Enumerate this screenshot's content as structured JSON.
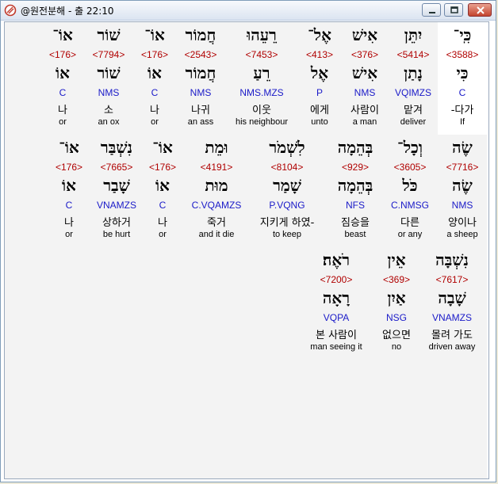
{
  "window": {
    "title": "@원전분해 - 출 22:10",
    "minimize_icon": "minimize-icon",
    "maximize_icon": "maximize-icon",
    "close_icon": "close-icon",
    "app_icon": "app-icon"
  },
  "rows": [
    {
      "words": [
        {
          "hebrew": "כִּֽי־",
          "strong": "<3588>",
          "lemma": "כִּי",
          "parse": "C",
          "korean": "-다가",
          "english": "If",
          "highlighted": true
        },
        {
          "hebrew": "יִתֵּן",
          "strong": "<5414>",
          "lemma": "נָתַן",
          "parse": "VQIMZS",
          "korean": "맡겨",
          "english": "deliver"
        },
        {
          "hebrew": "אִישׁ",
          "strong": "<376>",
          "lemma": "אִישׁ",
          "parse": "NMS",
          "korean": "사람이",
          "english": "a man"
        },
        {
          "hebrew": "אֶל־",
          "strong": "<413>",
          "lemma": "אֶל",
          "parse": "P",
          "korean": "에게",
          "english": "unto"
        },
        {
          "hebrew": "רֵעֵהוּ",
          "strong": "<7453>",
          "lemma": "רֵעַ",
          "parse": "NMS.MZS",
          "korean": "이웃",
          "english": "his neighbour"
        },
        {
          "hebrew": "חֲמוֹר",
          "strong": "<2543>",
          "lemma": "חֲמוֹר",
          "parse": "NMS",
          "korean": "나귀",
          "english": "an ass"
        },
        {
          "hebrew": "אוֹ־",
          "strong": "<176>",
          "lemma": "אוֹ",
          "parse": "C",
          "korean": "나",
          "english": "or"
        },
        {
          "hebrew": "שׁוֹר",
          "strong": "<7794>",
          "lemma": "שׁוֹר",
          "parse": "NMS",
          "korean": "소",
          "english": "an ox"
        },
        {
          "hebrew": "אוֹ־",
          "strong": "<176>",
          "lemma": "אוֹ",
          "parse": "C",
          "korean": "나",
          "english": "or"
        }
      ]
    },
    {
      "words": [
        {
          "hebrew": "שֶׂה",
          "strong": "<7716>",
          "lemma": "שֶׂה",
          "parse": "NMS",
          "korean": "양이나",
          "english": "a sheep"
        },
        {
          "hebrew": "וְכָל־",
          "strong": "<3605>",
          "lemma": "כֹּל",
          "parse": "C.NMSG",
          "korean": "다른",
          "english": "or any"
        },
        {
          "hebrew": "בְּהֵמָה",
          "strong": "<929>",
          "lemma": "בְּהֵמָה",
          "parse": "NFS",
          "korean": "짐승을",
          "english": "beast"
        },
        {
          "hebrew": "לִשְׁמֹר",
          "strong": "<8104>",
          "lemma": "שָׁמַר",
          "parse": "P.VQNG",
          "korean": "지키게 하였-",
          "english": "to keep"
        },
        {
          "hebrew": "וּמֵת",
          "strong": "<4191>",
          "lemma": "מוּת",
          "parse": "C.VQAMZS",
          "korean": "죽거",
          "english": "and it die"
        },
        {
          "hebrew": "אוֹ־",
          "strong": "<176>",
          "lemma": "אוֹ",
          "parse": "C",
          "korean": "나",
          "english": "or"
        },
        {
          "hebrew": "נִשְׁבַּר",
          "strong": "<7665>",
          "lemma": "שָׁבַר",
          "parse": "VNAMZS",
          "korean": "상하거",
          "english": "be hurt"
        },
        {
          "hebrew": "אוֹ־",
          "strong": "<176>",
          "lemma": "אוֹ",
          "parse": "C",
          "korean": "나",
          "english": "or"
        }
      ]
    },
    {
      "words": [
        {
          "hebrew": "נִשְׁבָּה",
          "strong": "<7617>",
          "lemma": "שָׁבָה",
          "parse": "VNAMZS",
          "korean": "몰려 가도",
          "english": "driven away"
        },
        {
          "hebrew": "אֵין",
          "strong": "<369>",
          "lemma": "אַיִן",
          "parse": "NSG",
          "korean": "없으면",
          "english": "no"
        },
        {
          "hebrew": "רֹאֶה׃",
          "strong": "<7200>",
          "lemma": "רָאָה",
          "parse": "VQPA",
          "korean": "본 사람이",
          "english": "man seeing it"
        }
      ]
    }
  ]
}
